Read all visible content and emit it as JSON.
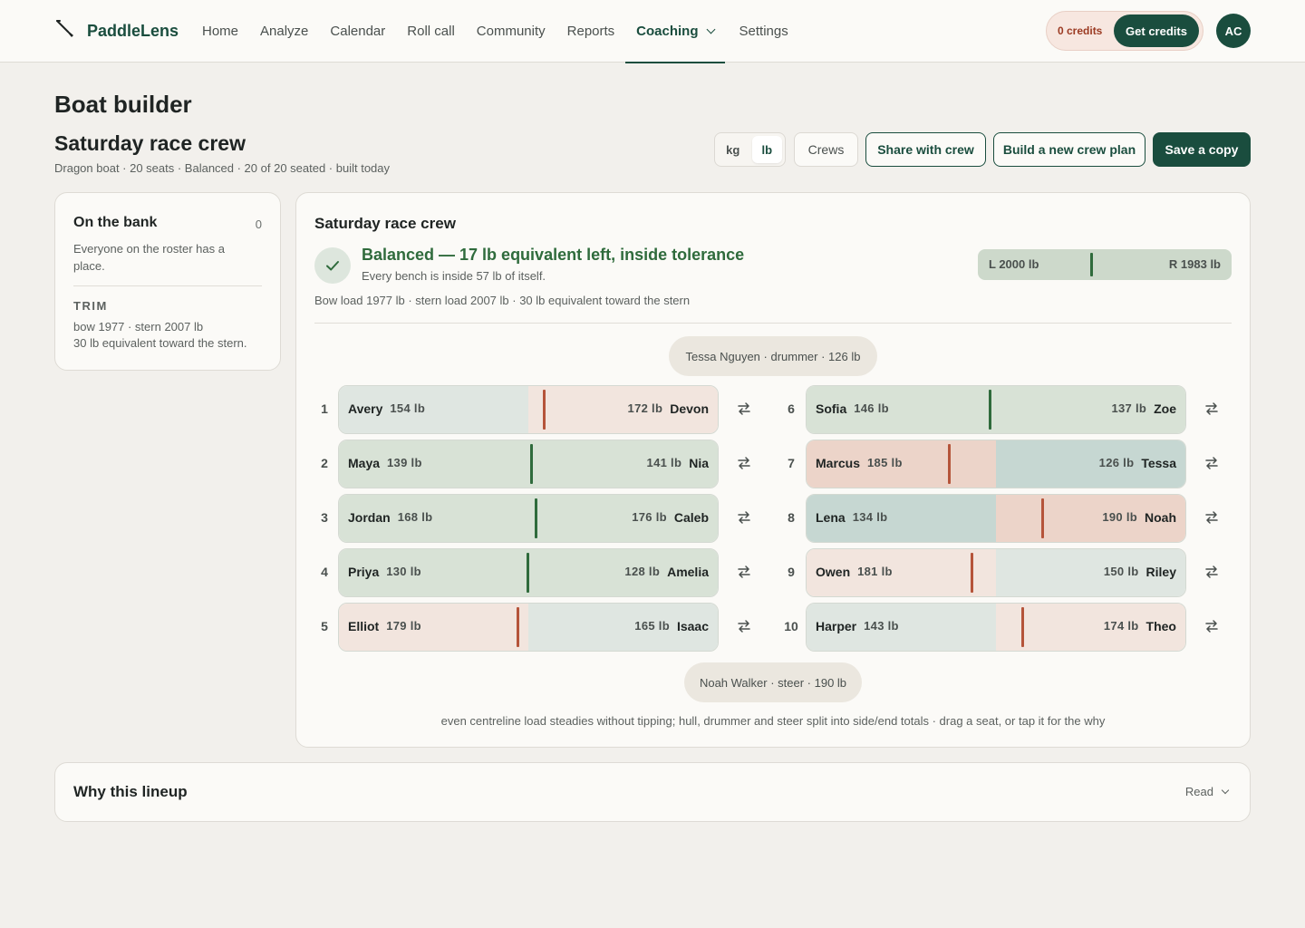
{
  "app": {
    "name": "PaddleLens"
  },
  "nav": [
    {
      "label": "Home"
    },
    {
      "label": "Analyze"
    },
    {
      "label": "Calendar"
    },
    {
      "label": "Roll call"
    },
    {
      "label": "Community"
    },
    {
      "label": "Reports"
    },
    {
      "label": "Coaching",
      "active": true
    },
    {
      "label": "Settings"
    }
  ],
  "credits": {
    "count_label": "0 credits",
    "cta": "Get credits"
  },
  "user": {
    "initials": "AC"
  },
  "page": {
    "title": "Boat builder",
    "crew_name": "Saturday race crew",
    "subtitle": "Dragon boat · 20 seats · Balanced · 20 of 20 seated · built today"
  },
  "toolbar": {
    "unit_kg": "kg",
    "unit_lb": "lb",
    "selected_unit": "lb",
    "crews": "Crews",
    "share": "Share with crew",
    "new_plan": "Build a new crew plan",
    "save": "Save a copy"
  },
  "bank": {
    "title": "On the bank",
    "count": "0",
    "description": "Everyone on the roster has a place.",
    "trim_label": "TRIM",
    "trim_line1": "bow 1977 · stern 2007 lb",
    "trim_line2": "30 lb equivalent toward the stern."
  },
  "boat": {
    "title": "Saturday race crew",
    "status_headline": "Balanced — 17 lb equivalent left, inside tolerance",
    "status_sub": "Every bench is inside 57 lb of itself.",
    "load_line": "Bow load 1977 lb · stern load 2007 lb · 30 lb equivalent toward the stern",
    "left_total": "L 2000 lb",
    "right_total": "R 1983 lb",
    "drummer": "Tessa Nguyen · drummer · 126 lb",
    "steer": "Noah Walker · steer · 190 lb",
    "footer": "even centreline load steadies without tipping; hull, drummer and steer split into side/end totals · drag a seat, or tap it for the why"
  },
  "benches": [
    {
      "num": "1",
      "left_name": "Avery",
      "left_wt": "154 lb",
      "right_name": "Devon",
      "right_wt": "172 lb",
      "balance": "right"
    },
    {
      "num": "2",
      "left_name": "Maya",
      "left_wt": "139 lb",
      "right_name": "Nia",
      "right_wt": "141 lb",
      "balance": "even"
    },
    {
      "num": "3",
      "left_name": "Jordan",
      "left_wt": "168 lb",
      "right_name": "Caleb",
      "right_wt": "176 lb",
      "balance": "even"
    },
    {
      "num": "4",
      "left_name": "Priya",
      "left_wt": "130 lb",
      "right_name": "Amelia",
      "right_wt": "128 lb",
      "balance": "even"
    },
    {
      "num": "5",
      "left_name": "Elliot",
      "left_wt": "179 lb",
      "right_name": "Isaac",
      "right_wt": "165 lb",
      "balance": "left"
    },
    {
      "num": "6",
      "left_name": "Sofia",
      "left_wt": "146 lb",
      "right_name": "Zoe",
      "right_wt": "137 lb",
      "balance": "even"
    },
    {
      "num": "7",
      "left_name": "Marcus",
      "left_wt": "185 lb",
      "right_name": "Tessa",
      "right_wt": "126 lb",
      "balance": "left"
    },
    {
      "num": "8",
      "left_name": "Lena",
      "left_wt": "134 lb",
      "right_name": "Noah",
      "right_wt": "190 lb",
      "balance": "right"
    },
    {
      "num": "9",
      "left_name": "Owen",
      "left_wt": "181 lb",
      "right_name": "Riley",
      "right_wt": "150 lb",
      "balance": "left"
    },
    {
      "num": "10",
      "left_name": "Harper",
      "left_wt": "143 lb",
      "right_name": "Theo",
      "right_wt": "174 lb",
      "balance": "right"
    }
  ],
  "why": {
    "title": "Why this lineup",
    "action": "Read"
  },
  "colors": {
    "brand": "#1a4d3e",
    "balanced": "#2f6b3c",
    "imbalance": "#b5543a"
  }
}
